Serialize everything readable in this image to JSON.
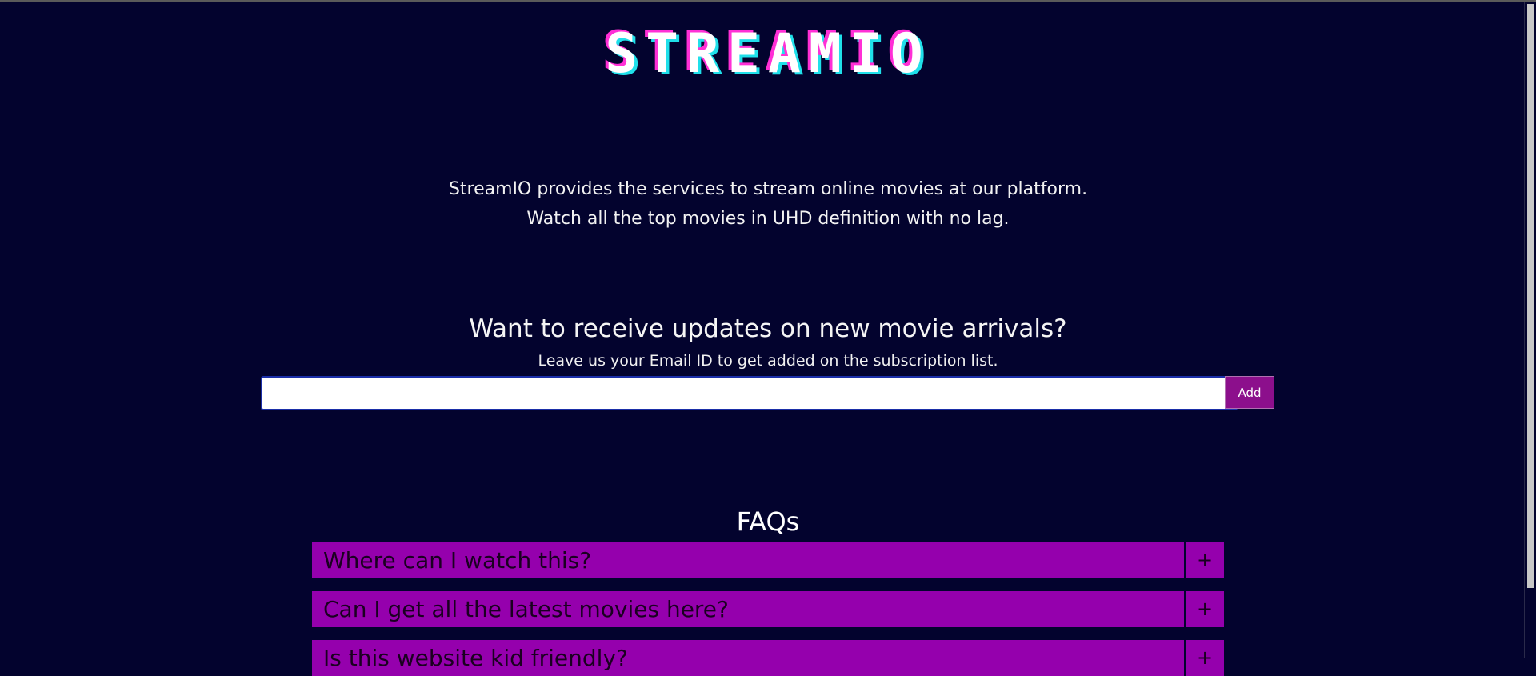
{
  "header": {
    "logo_text": "STREAMIO"
  },
  "intro": {
    "line1": "StreamIO provides the services to stream online movies at our platform.",
    "line2": "Watch all the top movies in UHD definition with no lag."
  },
  "subscribe": {
    "heading": "Want to receive updates on new movie arrivals?",
    "subtext": "Leave us your Email ID to get added on the subscription list.",
    "email_value": "",
    "email_placeholder": "",
    "add_label": "Add"
  },
  "faq": {
    "title": "FAQs",
    "items": [
      {
        "question": "Where can I watch this?",
        "toggle": "+"
      },
      {
        "question": "Can I get all the latest movies here?",
        "toggle": "+"
      },
      {
        "question": "Is this website kid friendly?",
        "toggle": "+"
      }
    ]
  },
  "colors": {
    "background": "#03032e",
    "accent": "#9500ad",
    "button": "#8c0f8c",
    "logo_pink": "#ff2fd6",
    "logo_cyan": "#1fe0ea"
  }
}
